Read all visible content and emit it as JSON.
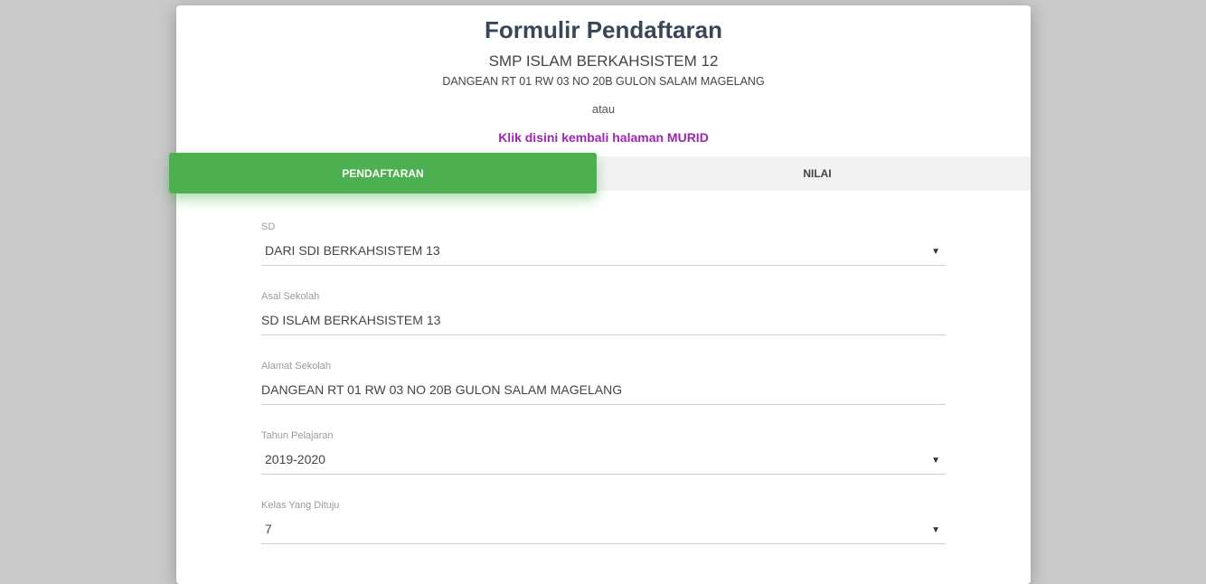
{
  "header": {
    "title": "Formulir Pendaftaran",
    "school_name": "SMP ISLAM BERKAHSISTEM 12",
    "school_address": "DANGEAN RT 01 RW 03 NO 20B GULON SALAM MAGELANG",
    "separator": "atau",
    "back_link": "Klik disini kembali halaman MURID"
  },
  "tabs": [
    {
      "label": "PENDAFTARAN",
      "active": true
    },
    {
      "label": "NILAI",
      "active": false
    }
  ],
  "form": {
    "sd": {
      "label": "SD",
      "value": "DARI SDI BERKAHSISTEM 13"
    },
    "asal_sekolah": {
      "label": "Asal Sekolah",
      "value": "SD ISLAM BERKAHSISTEM 13"
    },
    "alamat_sekolah": {
      "label": "Alamat Sekolah",
      "value": "DANGEAN RT 01 RW 03 NO 20B GULON SALAM MAGELANG"
    },
    "tahun_pelajaran": {
      "label": "Tahun Pelajaran",
      "value": "2019-2020"
    },
    "kelas": {
      "label": "Kelas Yang Dituju",
      "value": "7"
    }
  },
  "icons": {
    "select_caret": "triangle-down"
  },
  "colors": {
    "active_tab": "#4caf50",
    "link": "#9c27b0",
    "title": "#3a4556"
  }
}
